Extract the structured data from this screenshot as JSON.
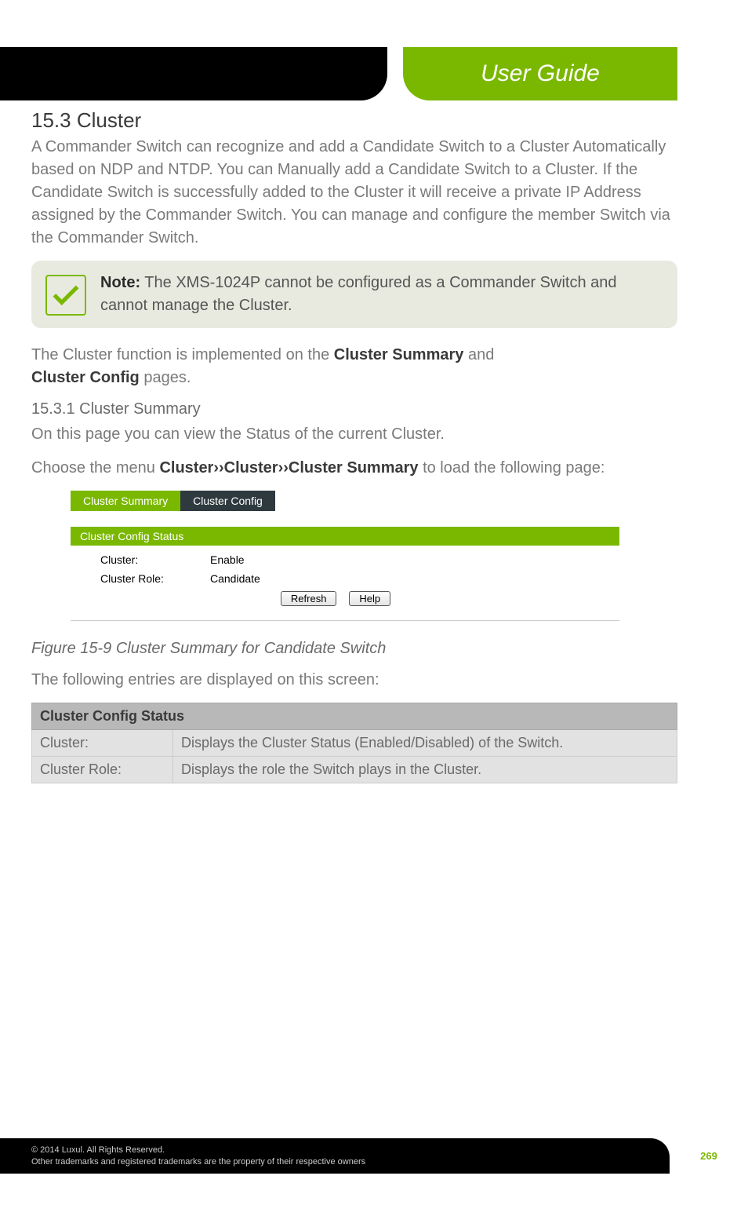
{
  "banner": {
    "title": "User Guide"
  },
  "section": {
    "heading": "15.3 Cluster",
    "intro": "A Commander Switch can recognize and add a Candidate Switch to a Cluster Automatically based on NDP and NTDP. You can Manually add a Candidate Switch to a Cluster. If the Candidate Switch is successfully added to the Cluster it will receive a private IP Address assigned by the Commander Switch. You can manage and configure the member Switch via the Commander Switch.",
    "note_label": "Note:",
    "note_text": " The XMS-1024P cannot be configured as a Commander Switch and cannot manage the Cluster.",
    "para2_pre": "The Cluster function is implemented on the ",
    "para2_b1": "Cluster Summary",
    "para2_mid": " and ",
    "para2_b2": "Cluster Config",
    "para2_post": " pages.",
    "sub_heading": "15.3.1 Cluster Summary",
    "sub_intro": "On this page you can view the Status of the current Cluster.",
    "menu_pre": "Choose the menu ",
    "menu_b": "Cluster››Cluster››Cluster Summary",
    "menu_post": " to load the following page:"
  },
  "embedded": {
    "tab_active": "Cluster Summary",
    "tab_inactive": "Cluster Config",
    "panel_title": "Cluster Config Status",
    "row1_label": "Cluster:",
    "row1_value": "Enable",
    "row2_label": "Cluster Role:",
    "row2_value": "Candidate",
    "btn_refresh": "Refresh",
    "btn_help": "Help"
  },
  "figure_caption": "Figure 15-9 Cluster Summary for Candidate Switch",
  "table_intro": "The following entries are displayed on this screen:",
  "table": {
    "header": "Cluster Config Status",
    "r1_label": "Cluster:",
    "r1_desc": "Displays the Cluster Status (Enabled/Disabled) of the Switch.",
    "r2_label": "Cluster Role:",
    "r2_desc": "Displays the role the Switch plays in the Cluster."
  },
  "footer": {
    "line1": "© 2014  Luxul. All Rights Reserved.",
    "line2": "Other trademarks and registered trademarks are the property of their respective owners",
    "page": "269"
  }
}
